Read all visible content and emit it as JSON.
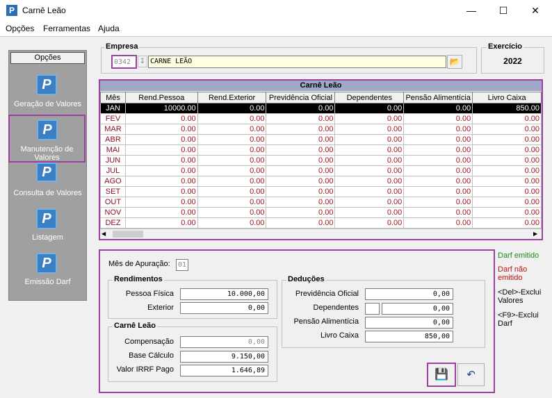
{
  "window": {
    "title": "Carnê Leão"
  },
  "menu": [
    "Opções",
    "Ferramentas",
    "Ajuda"
  ],
  "sidebar": {
    "header": "Opções",
    "items": [
      {
        "label_lines": [
          "Geração de Valores"
        ]
      },
      {
        "label_lines": [
          "Manutenção de",
          "Valores"
        ]
      },
      {
        "label_lines": [
          "Consulta de Valores"
        ]
      },
      {
        "label_lines": [
          "Listagem"
        ]
      },
      {
        "label_lines": [
          "Emissão Darf"
        ]
      }
    ]
  },
  "empresa": {
    "title": "Empresa",
    "code": "0342",
    "name": "CARNE LEÃO"
  },
  "exercicio": {
    "title": "Exercício",
    "value": "2022"
  },
  "grid": {
    "title": "Carnê Leão",
    "columns": [
      "Mês",
      "Rend.Pessoa",
      "Rend.Exterior",
      "Previdência Oficial",
      "Dependentes",
      "Pensão Alimentícia",
      "Livro Caixa"
    ],
    "rows": [
      [
        "JAN",
        "10000.00",
        "0.00",
        "0.00",
        "0.00",
        "0.00",
        "850.00"
      ],
      [
        "FEV",
        "0.00",
        "0.00",
        "0.00",
        "0.00",
        "0.00",
        "0.00"
      ],
      [
        "MAR",
        "0.00",
        "0.00",
        "0.00",
        "0.00",
        "0.00",
        "0.00"
      ],
      [
        "ABR",
        "0.00",
        "0.00",
        "0.00",
        "0.00",
        "0.00",
        "0.00"
      ],
      [
        "MAI",
        "0.00",
        "0.00",
        "0.00",
        "0.00",
        "0.00",
        "0.00"
      ],
      [
        "JUN",
        "0.00",
        "0.00",
        "0.00",
        "0.00",
        "0.00",
        "0.00"
      ],
      [
        "JUL",
        "0.00",
        "0.00",
        "0.00",
        "0.00",
        "0.00",
        "0.00"
      ],
      [
        "AGO",
        "0.00",
        "0.00",
        "0.00",
        "0.00",
        "0.00",
        "0.00"
      ],
      [
        "SET",
        "0.00",
        "0.00",
        "0.00",
        "0.00",
        "0.00",
        "0.00"
      ],
      [
        "OUT",
        "0.00",
        "0.00",
        "0.00",
        "0.00",
        "0.00",
        "0.00"
      ],
      [
        "NOV",
        "0.00",
        "0.00",
        "0.00",
        "0.00",
        "0.00",
        "0.00"
      ],
      [
        "DEZ",
        "0.00",
        "0.00",
        "0.00",
        "0.00",
        "0.00",
        "0.00"
      ]
    ]
  },
  "detail": {
    "mes_apuracao_label": "Mês de Apuração:",
    "mes_apuracao_value": "01",
    "rendimentos": {
      "title": "Rendimentos",
      "pessoa_fisica_label": "Pessoa Física",
      "pessoa_fisica_value": "10.000,00",
      "exterior_label": "Exterior",
      "exterior_value": "0,00"
    },
    "carne_leao": {
      "title": "Carnê Leão",
      "compensacao_label": "Compensação",
      "compensacao_value": "0,00",
      "base_calculo_label": "Base Cálculo",
      "base_calculo_value": "9.150,00",
      "irrf_label": "Valor IRRF Pago",
      "irrf_value": "1.646,89"
    },
    "deducoes": {
      "title": "Deduções",
      "previdencia_label": "Previdência Oficial",
      "previdencia_value": "0,00",
      "dependentes_label": "Dependentes",
      "dependentes_value": "0,00",
      "pensao_label": "Pensão Alimentícia",
      "pensao_value": "0,00",
      "livro_caixa_label": "Livro Caixa",
      "livro_caixa_value": "850,00"
    }
  },
  "legend": {
    "darf_emitido": "Darf emitido",
    "darf_nao_emitido_lines": [
      "Darf não",
      "emitido"
    ],
    "del_lines": [
      "<Del>-Exclui",
      "Valores"
    ],
    "f9_lines": [
      "<F9>-Exclui",
      "Darf"
    ],
    "colors": {
      "emitido": "#1a8c1a",
      "nao_emitido": "#c01010"
    }
  }
}
